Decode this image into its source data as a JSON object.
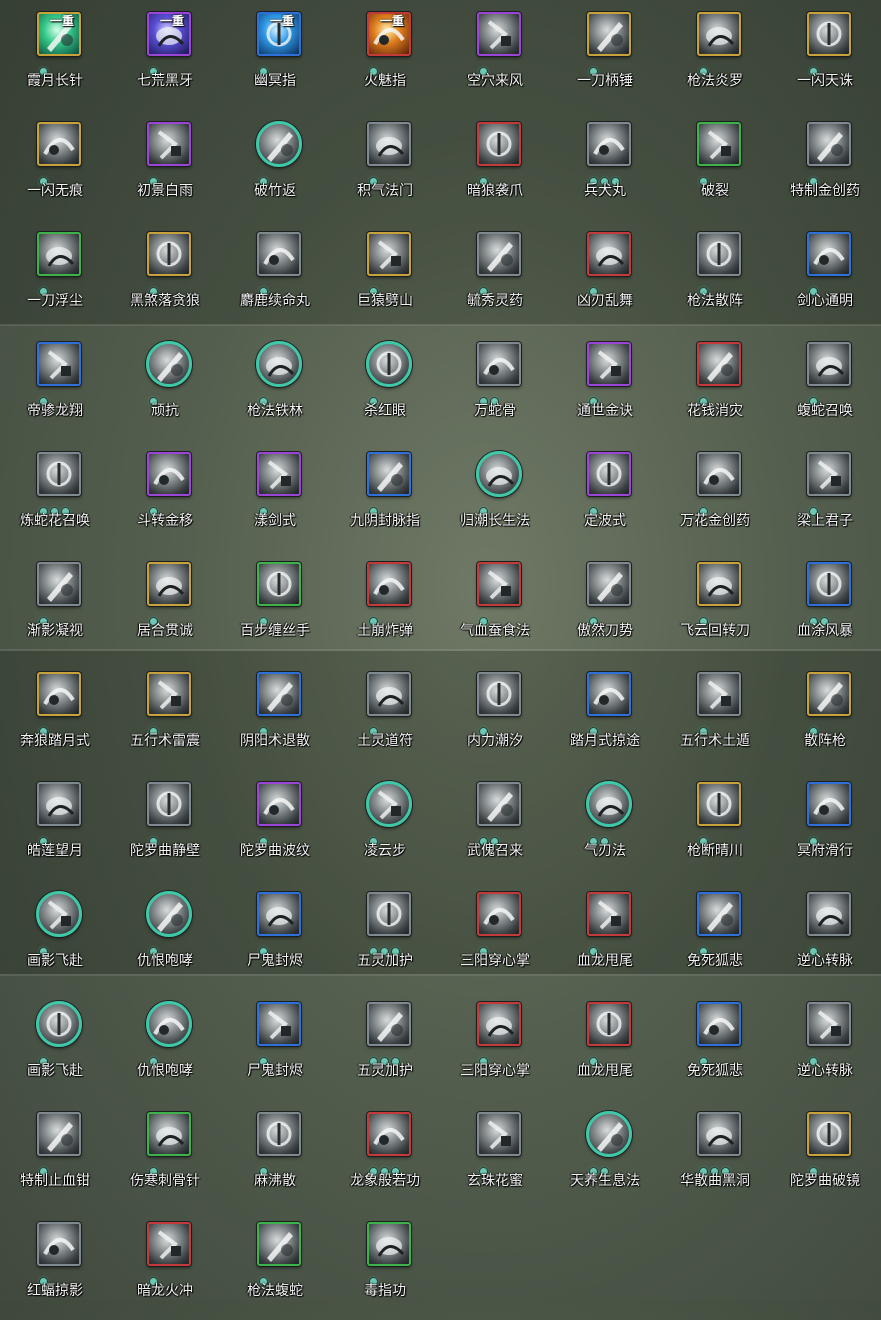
{
  "colors": {
    "frame": {
      "gold": "#c7a23a",
      "purple": "#9b45d6",
      "green": "#3db24a",
      "blue": "#2f6fd8",
      "red": "#c23a3a",
      "gray": "#7f8a90",
      "teal": "#3fc8a8"
    },
    "dot": "#6ec7b3",
    "art": {
      "green": [
        "#d8ffec",
        "#35c98a",
        "#0b4a3a"
      ],
      "purple": [
        "#d5d0ff",
        "#5a4fd6",
        "#1b1650"
      ],
      "blue": [
        "#d8f4ff",
        "#2f9ae8",
        "#0b2c5a"
      ],
      "orange": [
        "#fff0b0",
        "#e0801e",
        "#5a1e08"
      ]
    }
  },
  "skills": [
    {
      "name": "霞月长针",
      "frame": "gold",
      "dots": 1,
      "tier": "一重",
      "art": "green",
      "glyph": "slash-icon"
    },
    {
      "name": "七荒黑牙",
      "frame": "purple",
      "dots": 1,
      "tier": "一重",
      "art": "purple",
      "glyph": "fang-icon"
    },
    {
      "name": "幽冥指",
      "frame": "blue",
      "dots": 1,
      "tier": "一重",
      "art": "blue",
      "glyph": "finger-icon"
    },
    {
      "name": "火魅指",
      "frame": "red",
      "dots": 1,
      "tier": "一重",
      "art": "orange",
      "glyph": "flame-icon"
    },
    {
      "name": "空穴来风",
      "frame": "purple",
      "dots": 1,
      "glyph": "coin-icon"
    },
    {
      "name": "一刀柄锤",
      "frame": "gold",
      "dots": 1,
      "glyph": "hammer-icon"
    },
    {
      "name": "枪法炎罗",
      "frame": "gold",
      "dots": 1,
      "glyph": "spear-icon"
    },
    {
      "name": "一闪天诛",
      "frame": "gold",
      "dots": 1,
      "glyph": "lightning-icon"
    },
    {
      "name": "一闪无痕",
      "frame": "gold",
      "dots": 1,
      "glyph": "dash-icon"
    },
    {
      "name": "初景白雨",
      "frame": "purple",
      "dots": 1,
      "glyph": "rain-icon"
    },
    {
      "name": "破竹返",
      "frame": "teal",
      "round": true,
      "dots": 1,
      "glyph": "bamboo-icon"
    },
    {
      "name": "积气法门",
      "frame": "gray",
      "dots": 1,
      "glyph": "swirl-icon"
    },
    {
      "name": "暗狼袭爪",
      "frame": "red",
      "dots": 1,
      "glyph": "claw-icon"
    },
    {
      "name": "兵犬丸",
      "frame": "gray",
      "dots": 3,
      "glyph": "pill-icon"
    },
    {
      "name": "破裂",
      "frame": "green",
      "dots": 1,
      "glyph": "shatter-icon"
    },
    {
      "name": "特制金创药",
      "frame": "gray",
      "dots": 1,
      "glyph": "potion-icon"
    },
    {
      "name": "一刀浮尘",
      "frame": "green",
      "dots": 1,
      "glyph": "blade-icon"
    },
    {
      "name": "黑煞落贪狼",
      "frame": "gold",
      "dots": 1,
      "glyph": "wolf-icon"
    },
    {
      "name": "麝鹿续命丸",
      "frame": "gray",
      "dots": 1,
      "glyph": "deer-icon"
    },
    {
      "name": "巨猿劈山",
      "frame": "gold",
      "dots": 1,
      "glyph": "ape-icon"
    },
    {
      "name": "毓秀灵药",
      "frame": "gray",
      "dots": 1,
      "glyph": "gourd-icon"
    },
    {
      "name": "凶刃乱舞",
      "frame": "red",
      "dots": 1,
      "glyph": "dance-icon"
    },
    {
      "name": "枪法散阵",
      "frame": "gray",
      "dots": 1,
      "glyph": "spear-icon"
    },
    {
      "name": "剑心通明",
      "frame": "blue",
      "dots": 1,
      "glyph": "sword-icon"
    },
    {
      "name": "帝骖龙翔",
      "frame": "blue",
      "dots": 1,
      "glyph": "dragon-icon"
    },
    {
      "name": "顽抗",
      "frame": "teal",
      "round": true,
      "dots": 1,
      "glyph": "figure-icon"
    },
    {
      "name": "枪法铁林",
      "frame": "teal",
      "round": true,
      "dots": 1,
      "glyph": "cross-icon"
    },
    {
      "name": "杀红眼",
      "frame": "teal",
      "round": true,
      "dots": 1,
      "glyph": "helmet-icon"
    },
    {
      "name": "万蛇骨",
      "frame": "gray",
      "dots": 2,
      "glyph": "snake-icon"
    },
    {
      "name": "通世金诀",
      "frame": "purple",
      "dots": 1,
      "glyph": "dice-icon"
    },
    {
      "name": "花钱消灾",
      "frame": "red",
      "dots": 1,
      "glyph": "pouch-icon"
    },
    {
      "name": "蝮蛇召唤",
      "frame": "gray",
      "dots": 1,
      "glyph": "snake-icon"
    },
    {
      "name": "炼蛇花召唤",
      "frame": "gray",
      "dots": 3,
      "glyph": "flower-icon"
    },
    {
      "name": "斗转金移",
      "frame": "purple",
      "dots": 1,
      "glyph": "spiral-icon"
    },
    {
      "name": "漾剑式",
      "frame": "purple",
      "dots": 1,
      "glyph": "sword-icon"
    },
    {
      "name": "九阴封脉指",
      "frame": "blue",
      "dots": 1,
      "glyph": "finger-icon"
    },
    {
      "name": "归潮长生法",
      "frame": "teal",
      "round": true,
      "dots": 1,
      "glyph": "meditate-icon"
    },
    {
      "name": "定波式",
      "frame": "purple",
      "dots": 1,
      "glyph": "wave-icon"
    },
    {
      "name": "万花金创药",
      "frame": "gray",
      "dots": 1,
      "glyph": "potion-icon"
    },
    {
      "name": "梁上君子",
      "frame": "gray",
      "dots": 1,
      "glyph": "thief-icon"
    },
    {
      "name": "渐影凝视",
      "frame": "gray",
      "dots": 1,
      "glyph": "eye-icon"
    },
    {
      "name": "居合贯诚",
      "frame": "gold",
      "dots": 1,
      "glyph": "katana-icon"
    },
    {
      "name": "百步缠丝手",
      "frame": "green",
      "dots": 1,
      "glyph": "hand-icon"
    },
    {
      "name": "土崩炸弹",
      "frame": "red",
      "dots": 1,
      "glyph": "bomb-icon"
    },
    {
      "name": "气血蚕食法",
      "frame": "red",
      "dots": 1,
      "glyph": "wings-icon"
    },
    {
      "name": "傲然刀势",
      "frame": "gray",
      "dots": 1,
      "glyph": "blade-icon"
    },
    {
      "name": "飞云回转刀",
      "frame": "gold",
      "dots": 1,
      "glyph": "cloud-icon"
    },
    {
      "name": "血涂风暴",
      "frame": "blue",
      "dots": 2,
      "glyph": "storm-icon"
    },
    {
      "name": "奔狼踏月式",
      "frame": "gold",
      "dots": 1,
      "glyph": "wolf-icon"
    },
    {
      "name": "五行术雷震",
      "frame": "gold",
      "dots": 1,
      "glyph": "thunder-icon"
    },
    {
      "name": "阴阳术退散",
      "frame": "blue",
      "dots": 1,
      "glyph": "yinyang-icon"
    },
    {
      "name": "土灵道符",
      "frame": "gray",
      "dots": 1,
      "glyph": "talisman-icon"
    },
    {
      "name": "内力潮汐",
      "frame": "gray",
      "dots": 1,
      "glyph": "meditate-icon"
    },
    {
      "name": "踏月式掠途",
      "frame": "blue",
      "dots": 1,
      "glyph": "moon-icon"
    },
    {
      "name": "五行术土遁",
      "frame": "gray",
      "dots": 1,
      "glyph": "earth-icon"
    },
    {
      "name": "散阵枪",
      "frame": "gold",
      "dots": 1,
      "glyph": "spear-icon"
    },
    {
      "name": "皓莲望月",
      "frame": "gray",
      "dots": 1,
      "glyph": "crescent-icon"
    },
    {
      "name": "陀罗曲静壁",
      "frame": "gray",
      "dots": 1,
      "glyph": "shield-icon"
    },
    {
      "name": "陀罗曲波纹",
      "frame": "purple",
      "dots": 1,
      "glyph": "ripple-icon"
    },
    {
      "name": "凌云步",
      "frame": "teal",
      "round": true,
      "dots": 1,
      "glyph": "crescent-icon"
    },
    {
      "name": "武傀召来",
      "frame": "gray",
      "dots": 2,
      "glyph": "puppet-icon"
    },
    {
      "name": "气刃法",
      "frame": "teal",
      "round": true,
      "dots": 2,
      "glyph": "wind-blade-icon"
    },
    {
      "name": "枪断晴川",
      "frame": "gold",
      "dots": 1,
      "glyph": "lightning-icon"
    },
    {
      "name": "冥府滑行",
      "frame": "blue",
      "dots": 1,
      "glyph": "horse-icon"
    },
    {
      "name": "画影飞赴",
      "frame": "teal",
      "round": true,
      "dots": 1,
      "glyph": "no-sword-icon"
    },
    {
      "name": "仇恨咆哮",
      "frame": "teal",
      "round": true,
      "dots": 1,
      "glyph": "roar-icon"
    },
    {
      "name": "尸鬼封烬",
      "frame": "blue",
      "dots": 1,
      "glyph": "orb-icon"
    },
    {
      "name": "五灵加护",
      "frame": "gray",
      "dots": 3,
      "glyph": "altar-icon"
    },
    {
      "name": "三阳穿心掌",
      "frame": "red",
      "dots": 1,
      "glyph": "palm-icon"
    },
    {
      "name": "血龙甩尾",
      "frame": "red",
      "dots": 1,
      "glyph": "tail-icon"
    },
    {
      "name": "免死狐悲",
      "frame": "blue",
      "dots": 1,
      "glyph": "fox-icon"
    },
    {
      "name": "逆心转脉",
      "frame": "gray",
      "dots": 1,
      "glyph": "swirl-icon"
    },
    {
      "name": "画影飞赴",
      "frame": "teal",
      "round": true,
      "dots": 1,
      "glyph": "no-sword-icon"
    },
    {
      "name": "仇恨咆哮",
      "frame": "teal",
      "round": true,
      "dots": 1,
      "glyph": "roar-icon"
    },
    {
      "name": "尸鬼封烬",
      "frame": "blue",
      "dots": 1,
      "glyph": "orb-icon"
    },
    {
      "name": "五灵加护",
      "frame": "gray",
      "dots": 3,
      "glyph": "altar-icon"
    },
    {
      "name": "三阳穿心掌",
      "frame": "red",
      "dots": 1,
      "glyph": "palm-icon"
    },
    {
      "name": "血龙甩尾",
      "frame": "red",
      "dots": 1,
      "glyph": "tail-icon"
    },
    {
      "name": "免死狐悲",
      "frame": "blue",
      "dots": 1,
      "glyph": "fox-icon"
    },
    {
      "name": "逆心转脉",
      "frame": "gray",
      "dots": 1,
      "glyph": "swirl-icon"
    },
    {
      "name": "特制止血钳",
      "frame": "gray",
      "dots": 1,
      "glyph": "forceps-icon"
    },
    {
      "name": "伤寒刺骨针",
      "frame": "green",
      "dots": 1,
      "glyph": "needle-icon"
    },
    {
      "name": "麻沸散",
      "frame": "gray",
      "dots": 1,
      "glyph": "powder-icon"
    },
    {
      "name": "龙象般若功",
      "frame": "red",
      "dots": 3,
      "glyph": "dragon-icon"
    },
    {
      "name": "玄珠花蜜",
      "frame": "gray",
      "dots": 1,
      "glyph": "flower-icon"
    },
    {
      "name": "天养生息法",
      "frame": "teal",
      "round": true,
      "dots": 2,
      "glyph": "meditate-icon"
    },
    {
      "name": "华散曲黑洞",
      "frame": "gray",
      "dots": 3,
      "glyph": "blackhole-icon"
    },
    {
      "name": "陀罗曲破镜",
      "frame": "gold",
      "dots": 1,
      "glyph": "mirror-icon"
    },
    {
      "name": "红蝠掠影",
      "frame": "gray",
      "dots": 1,
      "glyph": "bat-icon"
    },
    {
      "name": "暗龙火冲",
      "frame": "red",
      "dots": 1,
      "glyph": "fire-pillar-icon"
    },
    {
      "name": "枪法蝮蛇",
      "frame": "green",
      "dots": 1,
      "glyph": "snake-icon"
    },
    {
      "name": "毒指功",
      "frame": "green",
      "dots": 1,
      "glyph": "finger-icon"
    }
  ]
}
